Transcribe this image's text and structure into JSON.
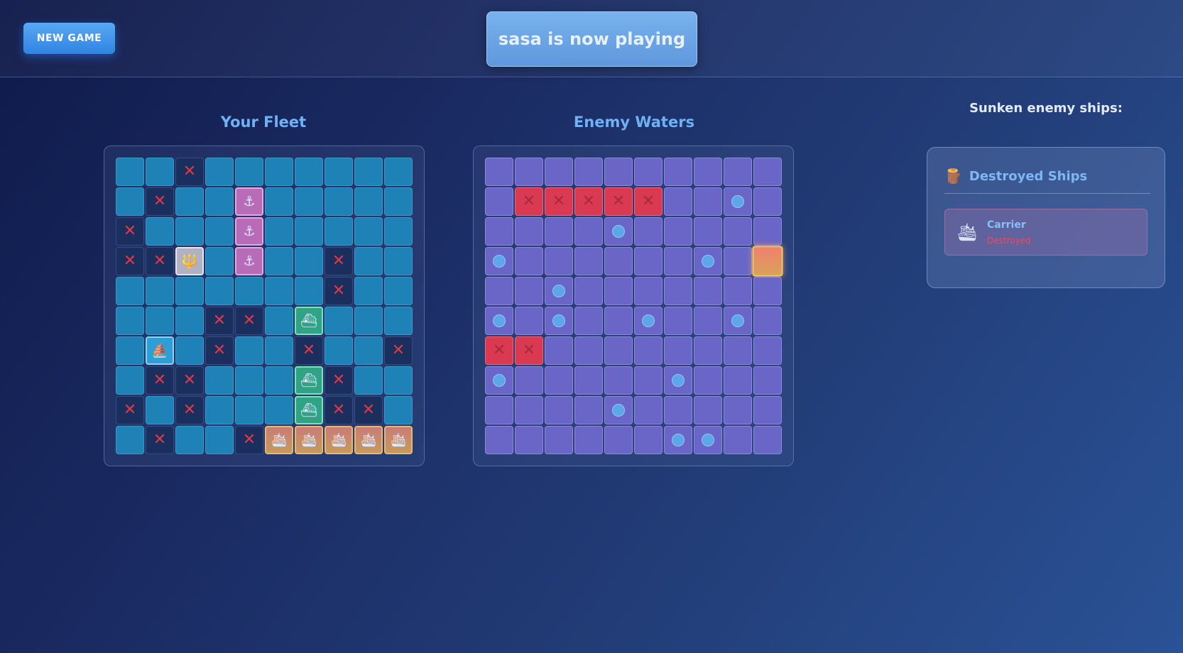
{
  "header": {
    "new_game_label": "NEW GAME",
    "status_text": "sasa is now playing"
  },
  "your_fleet": {
    "title": "Your Fleet",
    "rows": [
      [
        "water",
        "water",
        "miss",
        "water",
        "water",
        "water",
        "water",
        "water",
        "water",
        "water"
      ],
      [
        "water",
        "miss",
        "water",
        "water",
        "destroyer",
        "water",
        "water",
        "water",
        "water",
        "water"
      ],
      [
        "miss",
        "water",
        "water",
        "water",
        "destroyer",
        "water",
        "water",
        "water",
        "water",
        "water"
      ],
      [
        "miss",
        "miss",
        "sub",
        "water",
        "destroyer",
        "water",
        "water",
        "miss",
        "water",
        "water"
      ],
      [
        "water",
        "water",
        "water",
        "water",
        "water",
        "water",
        "water",
        "miss",
        "water",
        "water"
      ],
      [
        "water",
        "water",
        "water",
        "miss",
        "miss",
        "water",
        "cruiser",
        "water",
        "water",
        "water"
      ],
      [
        "water",
        "patrol",
        "water",
        "miss",
        "water",
        "water",
        "miss",
        "water",
        "water",
        "miss"
      ],
      [
        "water",
        "miss",
        "miss",
        "water",
        "water",
        "water",
        "cruiser",
        "miss",
        "water",
        "water"
      ],
      [
        "miss",
        "water",
        "miss",
        "water",
        "water",
        "water",
        "cruiser",
        "miss",
        "miss",
        "water"
      ],
      [
        "water",
        "miss",
        "water",
        "water",
        "miss",
        "carrier",
        "carrier",
        "carrier",
        "carrier",
        "carrier"
      ]
    ]
  },
  "enemy_waters": {
    "title": "Enemy Waters",
    "rows": [
      [
        "unknown",
        "unknown",
        "unknown",
        "unknown",
        "unknown",
        "unknown",
        "unknown",
        "unknown",
        "unknown",
        "unknown"
      ],
      [
        "unknown",
        "hit",
        "hit",
        "hit",
        "hit",
        "hit",
        "unknown",
        "unknown",
        "miss",
        "unknown"
      ],
      [
        "unknown",
        "unknown",
        "unknown",
        "unknown",
        "miss",
        "unknown",
        "unknown",
        "unknown",
        "unknown",
        "unknown"
      ],
      [
        "miss",
        "unknown",
        "unknown",
        "unknown",
        "unknown",
        "unknown",
        "unknown",
        "miss",
        "unknown",
        "target"
      ],
      [
        "unknown",
        "unknown",
        "miss",
        "unknown",
        "unknown",
        "unknown",
        "unknown",
        "unknown",
        "unknown",
        "unknown"
      ],
      [
        "miss",
        "unknown",
        "miss",
        "unknown",
        "unknown",
        "miss",
        "unknown",
        "unknown",
        "miss",
        "unknown"
      ],
      [
        "hit",
        "hit",
        "unknown",
        "unknown",
        "unknown",
        "unknown",
        "unknown",
        "unknown",
        "unknown",
        "unknown"
      ],
      [
        "miss",
        "unknown",
        "unknown",
        "unknown",
        "unknown",
        "unknown",
        "miss",
        "unknown",
        "unknown",
        "unknown"
      ],
      [
        "unknown",
        "unknown",
        "unknown",
        "unknown",
        "miss",
        "unknown",
        "unknown",
        "unknown",
        "unknown",
        "unknown"
      ],
      [
        "unknown",
        "unknown",
        "unknown",
        "unknown",
        "unknown",
        "unknown",
        "miss",
        "miss",
        "unknown",
        "unknown"
      ]
    ]
  },
  "sunken": {
    "title": "Sunken enemy ships:",
    "panel_title": "Destroyed Ships",
    "panel_icon": "shipwreck-icon",
    "ships": [
      {
        "name": "Carrier",
        "status": "Destroyed",
        "icon": "carrier-icon"
      }
    ]
  },
  "icons": {
    "miss": "✕",
    "destroyer": "⚓",
    "sub": "🔱",
    "cruiser": "⛴",
    "patrol": "⛵",
    "carrier": "🛳",
    "shipwreck": "🪵"
  },
  "colors": {
    "accent": "#6fb1f3",
    "hit": "#d93a52",
    "miss_mark": "#e03848",
    "water": "#1f82b6",
    "enemy_cell": "#6a66c8"
  }
}
